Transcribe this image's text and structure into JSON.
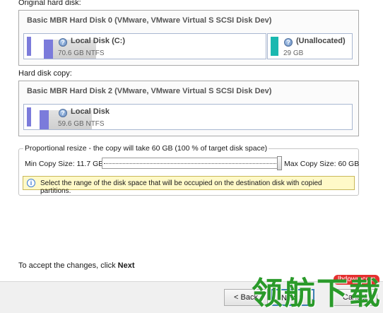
{
  "original": {
    "label": "Original hard disk:",
    "disk_title": "Basic MBR Hard Disk 0 (VMware, VMware Virtual S SCSI Disk Dev)",
    "partitions": [
      {
        "name": "Local Disk (C:)",
        "size": "70.6 GB NTFS"
      },
      {
        "name": "(Unallocated)",
        "size": "29 GB"
      }
    ]
  },
  "copy": {
    "label": "Hard disk copy:",
    "disk_title": "Basic MBR Hard Disk 2 (VMware, VMware Virtual S SCSI Disk Dev)",
    "partitions": [
      {
        "name": "Local Disk",
        "size": "59.6 GB NTFS"
      }
    ]
  },
  "resize": {
    "legend": "Proportional resize - the copy will take 60 GB (100 % of target disk space)",
    "min_label": "Min Copy Size:  11.7 GB",
    "max_label": "Max Copy Size:  60 GB",
    "slider_value_percent": 100,
    "info": "Select the range of the disk space that will be occupied on the destination disk with copied partitions."
  },
  "footer": {
    "prompt_text": "To accept the changes, click ",
    "prompt_bold": "Next",
    "back_label": "< Back",
    "next_label": "Next >",
    "cancel_label": "Cancel"
  },
  "watermark": {
    "text": "领航下载",
    "site": "lhdown.com"
  },
  "colors": {
    "partition_blue": "#7b7bdb",
    "unallocated_teal": "#1ab8b0",
    "info_bg": "#fff9c8"
  },
  "icons": {
    "partition": "question-disk-icon",
    "info": "info-icon"
  }
}
